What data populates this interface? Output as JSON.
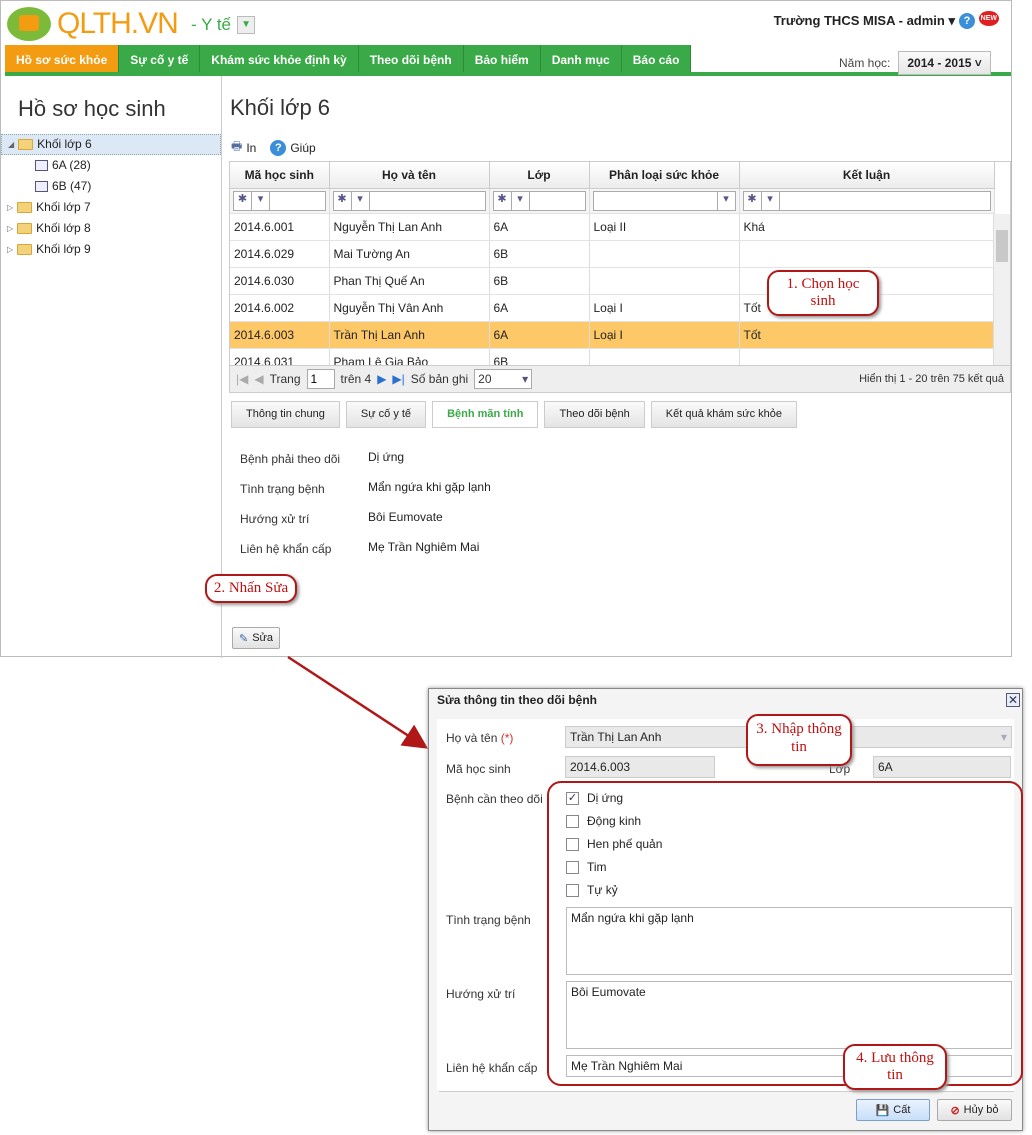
{
  "header": {
    "logo": "QLTH.VN",
    "module": "- Y tế",
    "user": "Trường THCS MISA - admin ▾",
    "new_badge": "NEW"
  },
  "nav": {
    "items": [
      "Hồ sơ sức khỏe",
      "Sự cố y tế",
      "Khám sức khỏe định kỳ",
      "Theo dõi bệnh",
      "Bảo hiểm",
      "Danh mục",
      "Báo cáo"
    ],
    "active": 0,
    "year_label": "Năm học:",
    "year_value": "2014 - 2015"
  },
  "sidebar": {
    "title": "Hồ sơ học sinh",
    "tree": [
      {
        "label": "Khối lớp 6",
        "expanded": true,
        "children": [
          "6A (28)",
          "6B (47)"
        ]
      },
      {
        "label": "Khối lớp 7"
      },
      {
        "label": "Khối lớp 8"
      },
      {
        "label": "Khối lớp 9"
      }
    ]
  },
  "main": {
    "title": "Khối lớp 6",
    "toolbar": {
      "print": "In",
      "help": "Giúp"
    },
    "columns": [
      "Mã học sinh",
      "Họ và tên",
      "Lớp",
      "Phân loại sức khỏe",
      "Kết luận"
    ],
    "rows": [
      [
        "2014.6.001",
        "Nguyễn Thị Lan Anh",
        "6A",
        "Loại II",
        "Khá"
      ],
      [
        "2014.6.029",
        "Mai Tường An",
        "6B",
        "",
        ""
      ],
      [
        "2014.6.030",
        "Phan Thị Quế An",
        "6B",
        "",
        ""
      ],
      [
        "2014.6.002",
        "Nguyễn Thị Vân Anh",
        "6A",
        "Loại I",
        "Tốt"
      ],
      [
        "2014.6.003",
        "Trần Thị Lan Anh",
        "6A",
        "Loại I",
        "Tốt"
      ],
      [
        "2014.6.031",
        "Phạm Lê Gia Bảo",
        "6B",
        "",
        ""
      ]
    ],
    "selected_row": 4,
    "pager": {
      "page_label": "Trang",
      "page": "1",
      "of": "trên 4",
      "size_label": "Số bản ghi",
      "size": "20",
      "summary": "Hiển thị 1 - 20 trên 75 kết quả"
    },
    "tabs": [
      "Thông tin chung",
      "Sự cố y tế",
      "Bệnh mãn tính",
      "Theo dõi bệnh",
      "Kết quả khám sức khỏe"
    ],
    "active_tab": 2,
    "details": [
      [
        "Bệnh phải theo dõi",
        "Dị ứng"
      ],
      [
        "Tình trạng bệnh",
        "Mẩn ngứa khi gặp lạnh"
      ],
      [
        "Hướng xử trí",
        "Bôi Eumovate"
      ],
      [
        "Liên hệ khẩn cấp",
        "Mẹ Trần Nghiêm Mai"
      ]
    ],
    "edit_button": "Sửa"
  },
  "dialog": {
    "title": "Sửa thông tin theo dõi bệnh",
    "name_label": "Họ và tên",
    "required": "(*)",
    "name": "Trần Thị Lan Anh",
    "code_label": "Mã học sinh",
    "code": "2014.6.003",
    "class_label": "Lớp",
    "class": "6A",
    "disease_label": "Bệnh cần theo dõi",
    "diseases": [
      {
        "label": "Dị ứng",
        "checked": true
      },
      {
        "label": "Động kinh",
        "checked": false
      },
      {
        "label": "Hen phế quản",
        "checked": false
      },
      {
        "label": "Tim",
        "checked": false
      },
      {
        "label": "Tự kỷ",
        "checked": false
      }
    ],
    "status_label": "Tình trạng bệnh",
    "status": "Mẩn ngứa khi gặp lạnh",
    "treatment_label": "Hướng xử trí",
    "treatment": "Bôi Eumovate",
    "contact_label": "Liên hệ khẩn cấp",
    "contact": "Mẹ Trần Nghiêm Mai",
    "save": "Cất",
    "cancel": "Hủy bỏ"
  },
  "callouts": [
    "1. Chọn học sinh",
    "2. Nhấn Sửa",
    "3. Nhập thông tin",
    "4. Lưu thông tin"
  ],
  "colors": {
    "green": "#3aaa48",
    "orange": "#f39c12",
    "selected": "#fdc868",
    "callout": "#b01818"
  }
}
